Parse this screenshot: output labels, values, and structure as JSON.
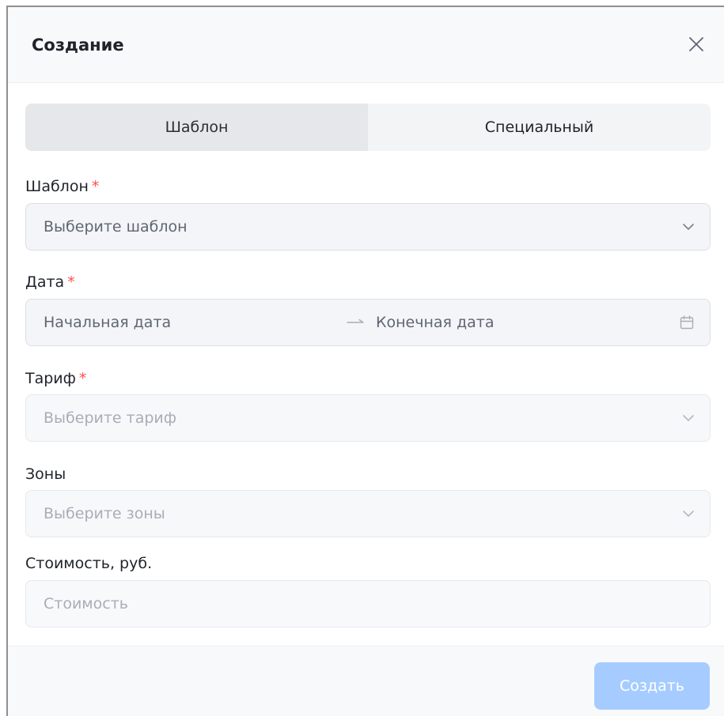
{
  "dialog": {
    "title": "Создание",
    "close_icon": "close-icon"
  },
  "tabs": [
    {
      "label": "Шаблон",
      "active": true
    },
    {
      "label": "Специальный",
      "active": false
    }
  ],
  "form": {
    "template": {
      "label": "Шаблон",
      "required_mark": "*",
      "placeholder": "Выберите шаблон"
    },
    "date": {
      "label": "Дата",
      "required_mark": "*",
      "start_placeholder": "Начальная дата",
      "end_placeholder": "Конечная дата"
    },
    "tariff": {
      "label": "Тариф",
      "required_mark": "*",
      "placeholder": "Выберите тариф"
    },
    "zones": {
      "label": "Зоны",
      "placeholder": "Выберите зоны"
    },
    "cost": {
      "label": "Стоимость, руб.",
      "placeholder": "Стоимость"
    }
  },
  "footer": {
    "submit_label": "Создать"
  },
  "colors": {
    "required": "#ff4d4f",
    "primary_disabled": "#a6ccff"
  }
}
